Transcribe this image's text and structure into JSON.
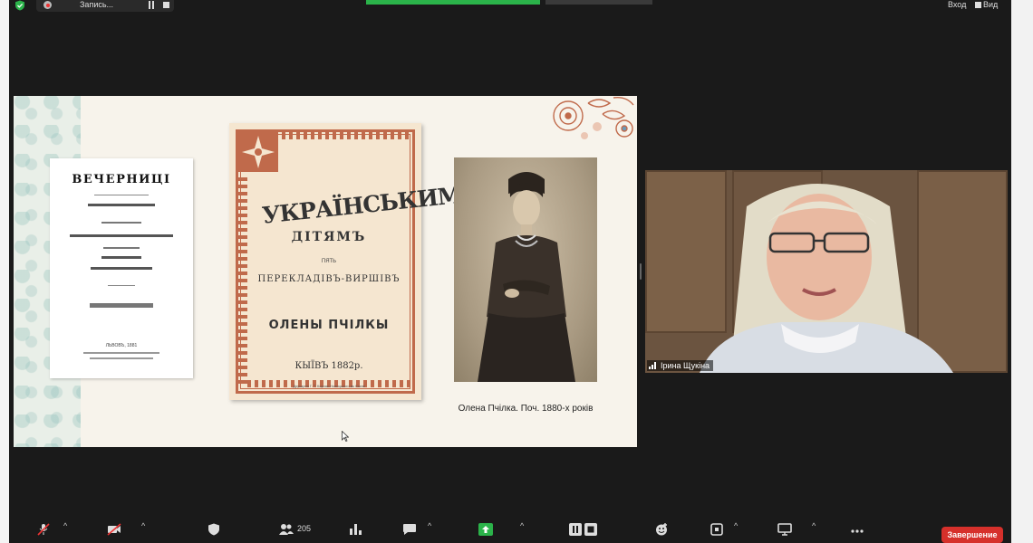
{
  "topbar": {
    "recording_label": "Запись...",
    "enter_label": "Вход",
    "view_label": "Вид"
  },
  "slide": {
    "book1": {
      "title": "ВЕЧЕРНИЦІ",
      "lines": [
        "(ПОВІДАННЯ М. ГОГОЛЯ)",
        "МИХАЙЛА ВЄЛИЧКОВСЬКОГО І ЛЮДУ УКРАЇНСЬКОГО",
        "ОЛЕНИ ПЧІЛКИ",
        "НАКЛАДОМЪ М. ТКАЧЕНКА"
      ],
      "place": "ЛЬВОВЪ, 1881"
    },
    "book2": {
      "line1": "УКРАЇНСЬКИМЪ",
      "line2": "ДІТЯМЪ",
      "line3": "ПЯТЬ",
      "line4": "ПЕРЕКЛАДІВЪ-ВИРШІВЪ",
      "line5": "ОЛЕНЫ ПЧІЛКЫ",
      "line6": "КЫЇВЪ 1882р.",
      "line7": "Друкарня Г. Т. Корчак-Новицького въ Кыеві"
    },
    "caption": "Олена Пчілка. Поч. 1880-х років"
  },
  "video": {
    "participant_name": "Ірина Щукіна"
  },
  "toolbar": {
    "participants_count": "205",
    "end_label": "Завершение"
  },
  "colors": {
    "record_green": "#2bb34a",
    "end_red": "#d6302b",
    "book_red": "#c06a4b"
  }
}
